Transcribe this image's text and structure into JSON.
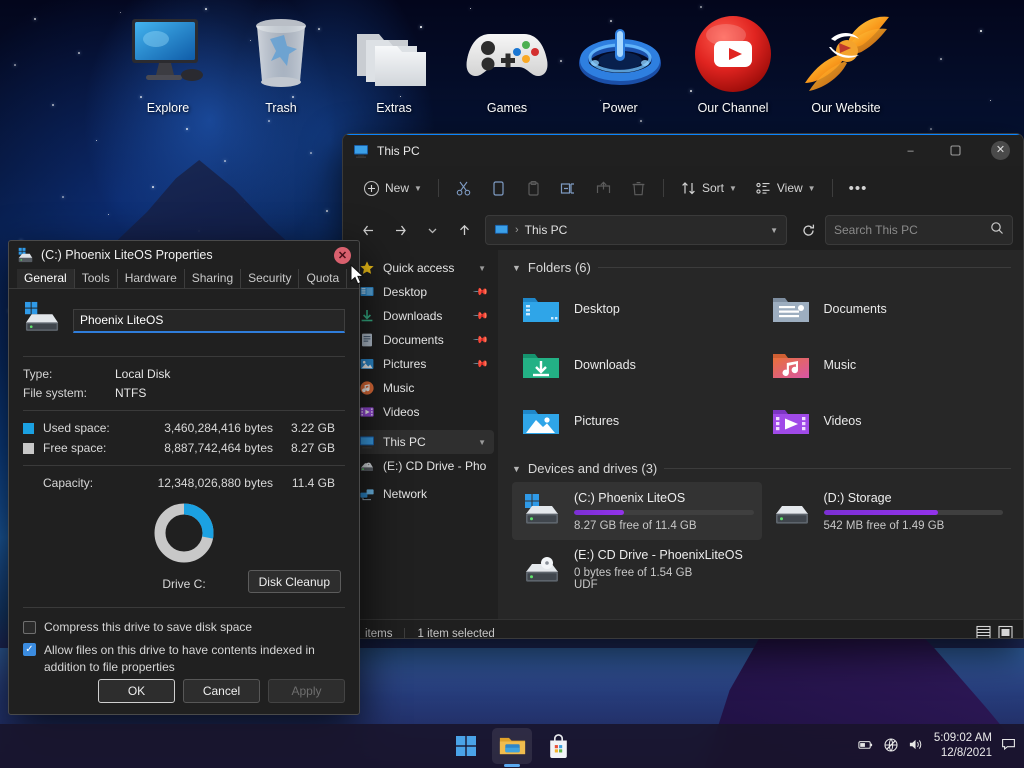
{
  "desktop": {
    "icons": [
      {
        "label": "Explore",
        "icon": "monitor-icon"
      },
      {
        "label": "Trash",
        "icon": "recycle-bin-icon"
      },
      {
        "label": "Extras",
        "icon": "folders-icon"
      },
      {
        "label": "Games",
        "icon": "game-controller-icon"
      },
      {
        "label": "Power",
        "icon": "power-ring-icon"
      },
      {
        "label": "Our Channel",
        "icon": "youtube-icon"
      },
      {
        "label": "Our Website",
        "icon": "phoenix-wings-icon"
      }
    ]
  },
  "explorer": {
    "title": "This PC",
    "window_buttons": {
      "minimize": "–",
      "maximize": "❐",
      "close": "✕"
    },
    "toolbar": {
      "new_label": "New",
      "sort_label": "Sort",
      "view_label": "View",
      "more_label": "•••",
      "icons": [
        "plus-icon",
        "cut-icon",
        "copy-icon",
        "paste-icon",
        "rename-icon",
        "share-icon",
        "delete-icon",
        "sort-icon",
        "view-icon",
        "more-icon"
      ]
    },
    "address": {
      "breadcrumb_root": "This PC",
      "separator": "›",
      "back_icon": "back-arrow-icon",
      "forward_icon": "forward-arrow-icon",
      "history_icon": "chevron-down-icon",
      "up_icon": "up-arrow-icon",
      "dropdown_icon": "chevron-down-icon",
      "refresh_icon": "refresh-icon"
    },
    "search": {
      "placeholder": "Search This PC",
      "icon": "search-icon"
    },
    "sidebar": {
      "groups": [
        {
          "label": "Quick access",
          "icon": "star-icon",
          "items": [
            {
              "label": "Desktop",
              "icon": "desktop-folder-icon",
              "pinned": true
            },
            {
              "label": "Downloads",
              "icon": "downloads-folder-icon",
              "pinned": true
            },
            {
              "label": "Documents",
              "icon": "documents-folder-icon",
              "pinned": true
            },
            {
              "label": "Pictures",
              "icon": "pictures-folder-icon",
              "pinned": true
            },
            {
              "label": "Music",
              "icon": "music-folder-icon",
              "pinned": false
            },
            {
              "label": "Videos",
              "icon": "videos-folder-icon",
              "pinned": false
            }
          ]
        }
      ],
      "this_pc": {
        "label": "This PC",
        "icon": "this-pc-icon",
        "selected": true
      },
      "cd_drive": {
        "label": "(E:) CD Drive - Phoer",
        "icon": "cd-drive-icon"
      },
      "network": {
        "label": "Network",
        "icon": "network-icon"
      }
    },
    "content": {
      "folders_header": "Folders (6)",
      "folders": [
        {
          "label": "Desktop",
          "icon": "desktop-folder-icon"
        },
        {
          "label": "Documents",
          "icon": "documents-folder-icon"
        },
        {
          "label": "Downloads",
          "icon": "downloads-folder-icon"
        },
        {
          "label": "Music",
          "icon": "music-folder-icon"
        },
        {
          "label": "Pictures",
          "icon": "pictures-folder-icon"
        },
        {
          "label": "Videos",
          "icon": "videos-folder-icon"
        }
      ],
      "devices_header": "Devices and drives (3)",
      "drives": [
        {
          "name": "(C:) Phoenix LiteOS",
          "sub": "8.27 GB free of 11.4 GB",
          "used_percent": 28,
          "bar_color": "#9333ea",
          "icon": "hard-drive-windows-icon",
          "selected": true
        },
        {
          "name": "(D:) Storage",
          "sub": "542 MB free of 1.49 GB",
          "used_percent": 64,
          "bar_color": "#9333ea",
          "icon": "hard-drive-icon",
          "selected": false
        },
        {
          "name": "(E:) CD Drive - PhoenixLiteOS",
          "sub": "0 bytes free of 1.54 GB",
          "sub2": "UDF",
          "used_percent": 0,
          "icon": "cd-drive-icon",
          "selected": false
        }
      ]
    },
    "status": {
      "items_text": "items",
      "selection_text": "1 item selected",
      "view_icons": [
        "details-view-icon",
        "large-icons-view-icon"
      ]
    }
  },
  "properties_dialog": {
    "title": "(C:) Phoenix LiteOS Properties",
    "title_icon": "hard-drive-icon",
    "close_label": "✕",
    "tabs": [
      {
        "label": "General",
        "active": true
      },
      {
        "label": "Tools",
        "active": false
      },
      {
        "label": "Hardware",
        "active": false
      },
      {
        "label": "Sharing",
        "active": false
      },
      {
        "label": "Security",
        "active": false
      },
      {
        "label": "Quota",
        "active": false
      }
    ],
    "volume_name": "Phoenix LiteOS",
    "drive_icon": "hard-drive-windows-icon",
    "type_label": "Type:",
    "type_value": "Local Disk",
    "fs_label": "File system:",
    "fs_value": "NTFS",
    "used_label": "Used space:",
    "used_bytes": "3,460,284,416 bytes",
    "used_gb": "3.22 GB",
    "used_color": "#1ba1e2",
    "free_label": "Free space:",
    "free_bytes": "8,887,742,464 bytes",
    "free_gb": "8.27 GB",
    "free_color": "#c8c8c8",
    "capacity_label": "Capacity:",
    "capacity_bytes": "12,348,026,880 bytes",
    "capacity_gb": "11.4 GB",
    "donut_used_percent": 28,
    "drive_caption": "Drive C:",
    "disk_cleanup_label": "Disk Cleanup",
    "compress_label": "Compress this drive to save disk space",
    "compress_checked": false,
    "index_label": "Allow files on this drive to have contents indexed in addition to file properties",
    "index_checked": true,
    "check_glyph": "✓",
    "ok_label": "OK",
    "cancel_label": "Cancel",
    "apply_label": "Apply"
  },
  "taskbar": {
    "apps": [
      {
        "name": "start-button",
        "icon": "windows-logo-icon"
      },
      {
        "name": "file-explorer",
        "icon": "file-explorer-icon",
        "active": true
      },
      {
        "name": "microsoft-store",
        "icon": "microsoft-store-icon"
      }
    ],
    "tray_icons": [
      "battery-icon",
      "network-disconnected-icon",
      "volume-icon"
    ],
    "time": "5:09:02 AM",
    "date": "12/8/2021",
    "notification_icon": "notification-icon"
  }
}
